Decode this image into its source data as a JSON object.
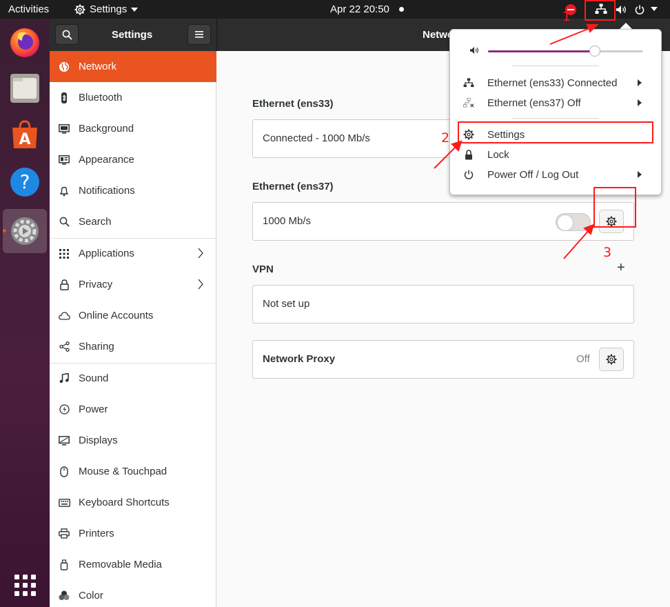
{
  "topbar": {
    "activities": "Activities",
    "app_name": "Settings",
    "clock": "Apr 22  20:50"
  },
  "dock": {
    "items": [
      "firefox-icon",
      "files-icon",
      "software-icon",
      "help-icon",
      "settings-icon",
      "show-apps-icon"
    ],
    "running_indicator": "settings"
  },
  "window": {
    "sidebar_title": "Settings",
    "content_title": "Netwo"
  },
  "sidebar": {
    "items": [
      {
        "label": "Network",
        "icon": "globe-icon",
        "active": true
      },
      {
        "label": "Bluetooth",
        "icon": "bluetooth-icon"
      },
      {
        "label": "Background",
        "icon": "background-icon"
      },
      {
        "label": "Appearance",
        "icon": "appearance-icon"
      },
      {
        "label": "Notifications",
        "icon": "bell-icon"
      },
      {
        "label": "Search",
        "icon": "search-icon"
      },
      {
        "label": "Applications",
        "icon": "grid-icon",
        "chevron": true
      },
      {
        "label": "Privacy",
        "icon": "lock-icon",
        "chevron": true
      },
      {
        "label": "Online Accounts",
        "icon": "cloud-icon"
      },
      {
        "label": "Sharing",
        "icon": "share-icon"
      },
      {
        "label": "Sound",
        "icon": "music-icon"
      },
      {
        "label": "Power",
        "icon": "power-icon"
      },
      {
        "label": "Displays",
        "icon": "display-icon"
      },
      {
        "label": "Mouse & Touchpad",
        "icon": "mouse-icon"
      },
      {
        "label": "Keyboard Shortcuts",
        "icon": "keyboard-icon"
      },
      {
        "label": "Printers",
        "icon": "printer-icon"
      },
      {
        "label": "Removable Media",
        "icon": "usb-icon"
      },
      {
        "label": "Color",
        "icon": "color-icon"
      }
    ]
  },
  "content": {
    "ethernet1_title": "Ethernet (ens33)",
    "ethernet1_status": "Connected - 1000 Mb/s",
    "ethernet2_title": "Ethernet (ens37)",
    "ethernet2_status": "1000 Mb/s",
    "ethernet2_switch_on": false,
    "vpn_title": "VPN",
    "vpn_add": "+",
    "vpn_status": "Not set up",
    "proxy_label": "Network Proxy",
    "proxy_status": "Off"
  },
  "popup": {
    "volume_level": 0.69,
    "items": [
      {
        "label": "Ethernet (ens33) Connected",
        "icon": "network-wired-icon",
        "submenu": true
      },
      {
        "label": "Ethernet (ens37) Off",
        "icon": "network-offline-icon",
        "submenu": true
      },
      {
        "label": "Settings",
        "icon": "gear-icon"
      },
      {
        "label": "Lock",
        "icon": "lock-icon"
      },
      {
        "label": "Power Off / Log Out",
        "icon": "power-icon",
        "submenu": true
      }
    ]
  },
  "annotations": {
    "labels": [
      "1",
      "2",
      "3"
    ],
    "color": "#ff1a1a"
  },
  "colors": {
    "accent": "#e95420",
    "volume_fill": "#8b2e7d",
    "topbar": "#1d1d1d"
  }
}
